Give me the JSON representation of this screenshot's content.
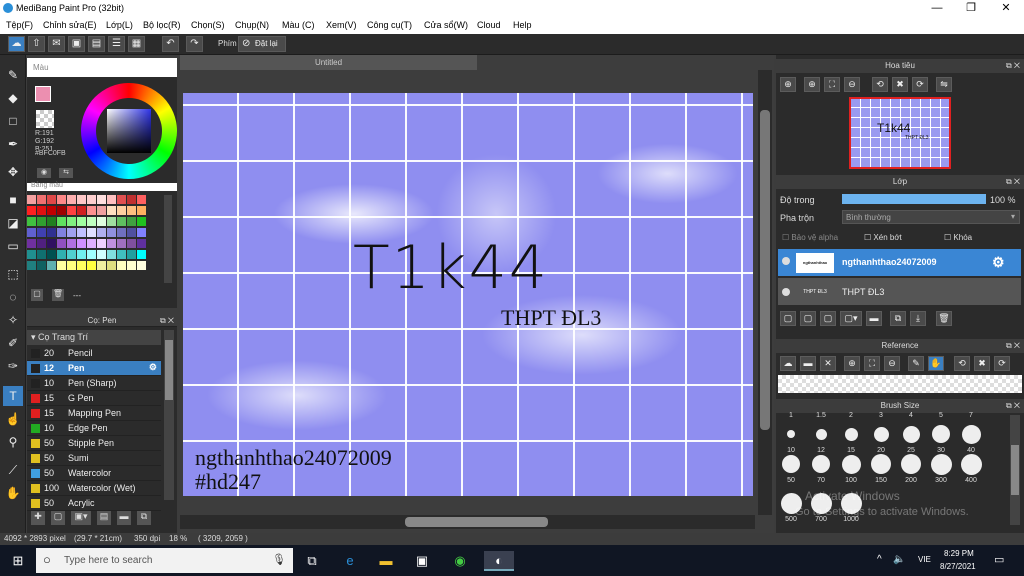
{
  "window": {
    "title": "MediBang Paint Pro (32bit)",
    "min": "—",
    "max": "❐",
    "close": "✕"
  },
  "menu": [
    "Tệp(F)",
    "Chỉnh sửa(E)",
    "Lớp(L)",
    "Bộ lọc(R)",
    "Chọn(S)",
    "Chụp(N)",
    "Màu (C)",
    "Xem(V)",
    "Công cụ(T)",
    "Cửa sổ(W)",
    "Cloud",
    "Help"
  ],
  "toolbar": {
    "phim_label": "Phím",
    "reset_label": "Đặt lại"
  },
  "color_panel": {
    "title": "Màu",
    "r": "R:191",
    "g": "G:192",
    "b": "B:251",
    "hex": "#BFC0FB",
    "primary_color": "#ec8fb0",
    "palette_title": "Bảng màu",
    "palette_more": "---"
  },
  "brush_panel": {
    "title": "Cọ: Pen",
    "group": "Cọ Trang Trí",
    "items": [
      {
        "size": "20",
        "name": "Pencil",
        "color": "#222222"
      },
      {
        "size": "12",
        "name": "Pen",
        "color": "#222222"
      },
      {
        "size": "10",
        "name": "Pen (Sharp)",
        "color": "#222222"
      },
      {
        "size": "15",
        "name": "G Pen",
        "color": "#e02020"
      },
      {
        "size": "15",
        "name": "Mapping Pen",
        "color": "#e02020"
      },
      {
        "size": "10",
        "name": "Edge Pen",
        "color": "#22aa22"
      },
      {
        "size": "50",
        "name": "Stipple Pen",
        "color": "#e0c020"
      },
      {
        "size": "50",
        "name": "Sumi",
        "color": "#e0c020"
      },
      {
        "size": "50",
        "name": "Watercolor",
        "color": "#40a0e0"
      },
      {
        "size": "100",
        "name": "Watercolor (Wet)",
        "color": "#e0c020"
      },
      {
        "size": "50",
        "name": "Acrylic",
        "color": "#e0c020"
      }
    ]
  },
  "canvas": {
    "tab_title": "Untitled",
    "text_main": "T1k44",
    "text_school": "THPT ĐL3",
    "text_user": "ngthanhthao24072009",
    "text_tag": "#hd247"
  },
  "navigator": {
    "title": "Hoa tiêu",
    "thumb_text": "T1k44",
    "thumb_sub": "THPT ĐL3"
  },
  "layer_panel": {
    "title": "Lớp",
    "opacity_label": "Độ trong",
    "opacity_value": "100 %",
    "opacity_fraction": 1.0,
    "blend_label": "Pha trộn",
    "blend_value": "Bình thường",
    "protect_alpha": "Bảo vệ alpha",
    "clip": "Xén bớt",
    "lock": "Khóa",
    "layers": [
      {
        "name": "ngthanhthao24072009",
        "thumb": "ngthanhthao"
      },
      {
        "name": "THPT ĐL3",
        "thumb": "THPT ĐL3"
      }
    ]
  },
  "reference_panel": {
    "title": "Reference"
  },
  "brushsize_panel": {
    "title": "Brush Size",
    "top_labels": [
      "1",
      "1.5",
      "2",
      "3",
      "4",
      "5",
      "7"
    ],
    "row1": [
      "10",
      "12",
      "15",
      "20",
      "25",
      "30",
      "40"
    ],
    "row2": [
      "50",
      "70",
      "100",
      "150",
      "200",
      "300",
      "400"
    ],
    "row3": [
      "500",
      "700",
      "1000"
    ]
  },
  "status": {
    "size": "4092 * 2893 pixel",
    "mm": "(29.7 * 21cm)",
    "dpi": "350 dpi",
    "zoom": "18 %",
    "coords": "( 3209, 2059 )"
  },
  "watermark": {
    "line1": "Activate Windows",
    "line2": "Go to Settings to activate Windows."
  },
  "taskbar": {
    "search_placeholder": "Type here to search",
    "lang": "VIE",
    "time": "8:29 PM",
    "date": "8/27/2021"
  }
}
